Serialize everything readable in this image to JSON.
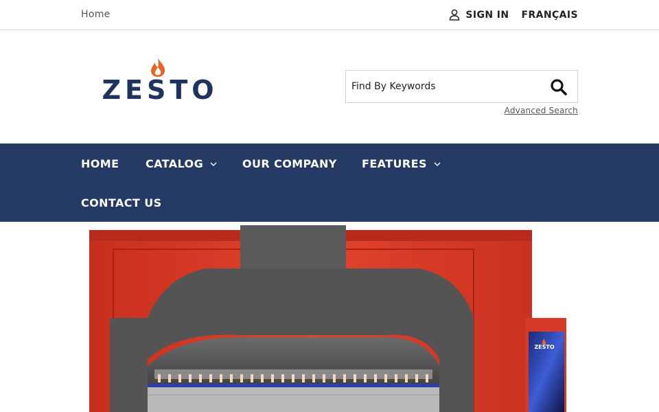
{
  "topbar": {
    "breadcrumb": "Home",
    "sign_in": "SIGN IN",
    "language": "FRANÇAIS"
  },
  "header": {
    "logo_text": "ZESTO",
    "search": {
      "placeholder": "Find By Keywords",
      "advanced_label": "Advanced Search"
    }
  },
  "nav": {
    "items": [
      {
        "label": "HOME",
        "has_dropdown": false
      },
      {
        "label": "CATALOG",
        "has_dropdown": true
      },
      {
        "label": "OUR COMPANY",
        "has_dropdown": false
      },
      {
        "label": "FEATURES",
        "has_dropdown": true
      },
      {
        "label": "CONTACT US",
        "has_dropdown": false
      }
    ]
  },
  "hero": {
    "oven_badge": "ZESTO"
  },
  "colors": {
    "nav_bg": "#243963",
    "brand_navy": "#1f3260",
    "flame_orange": "#e8652a",
    "oven_red": "#d93a26"
  },
  "icons": {
    "account": "user-icon",
    "search": "search-icon",
    "dropdown": "chevron-down-icon"
  }
}
